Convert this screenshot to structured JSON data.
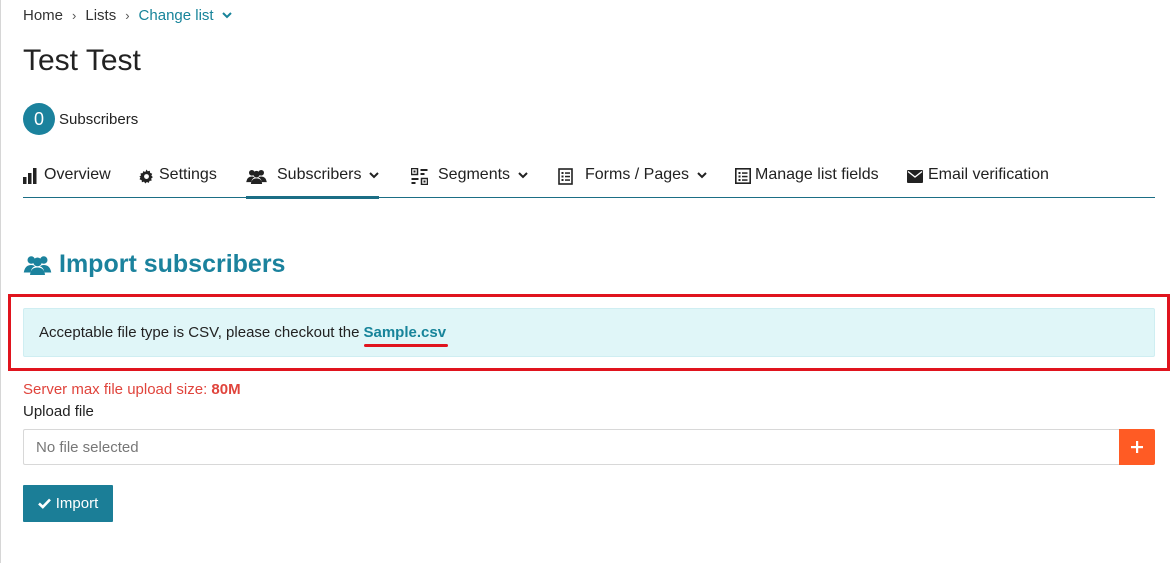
{
  "breadcrumb": {
    "home": "Home",
    "lists": "Lists",
    "change_list": "Change list",
    "separator": "›"
  },
  "list": {
    "title": "Test Test",
    "subscriber_count": "0",
    "subscriber_label": "Subscribers"
  },
  "tabs": [
    {
      "label": "Overview",
      "icon": "bar-chart-icon"
    },
    {
      "label": "Settings",
      "icon": "gear-icon"
    },
    {
      "label": "Subscribers",
      "icon": "users-icon",
      "active": true,
      "dropdown": true
    },
    {
      "label": "Segments",
      "icon": "segments-icon",
      "dropdown": true
    },
    {
      "label": "Forms / Pages",
      "icon": "form-icon",
      "dropdown": true
    },
    {
      "label": "Manage list fields",
      "icon": "fields-icon"
    },
    {
      "label": "Email verification",
      "icon": "envelope-icon"
    }
  ],
  "section": {
    "title": "Import subscribers",
    "icon": "users-icon"
  },
  "info": {
    "text": "Acceptable file type is CSV, please checkout the",
    "link": "Sample.csv"
  },
  "upload": {
    "limit_label": "Server max file upload size:",
    "limit_value": "80M",
    "label": "Upload file",
    "placeholder": "No file selected",
    "add_icon": "plus-icon"
  },
  "import_button": {
    "label": "Import",
    "icon": "check-icon"
  },
  "colors": {
    "accent": "#1b829d",
    "annotation": "#e0141e",
    "add_button": "#ff5b24",
    "info_bg": "#e0f6f8",
    "warning_text": "#e0443c"
  }
}
